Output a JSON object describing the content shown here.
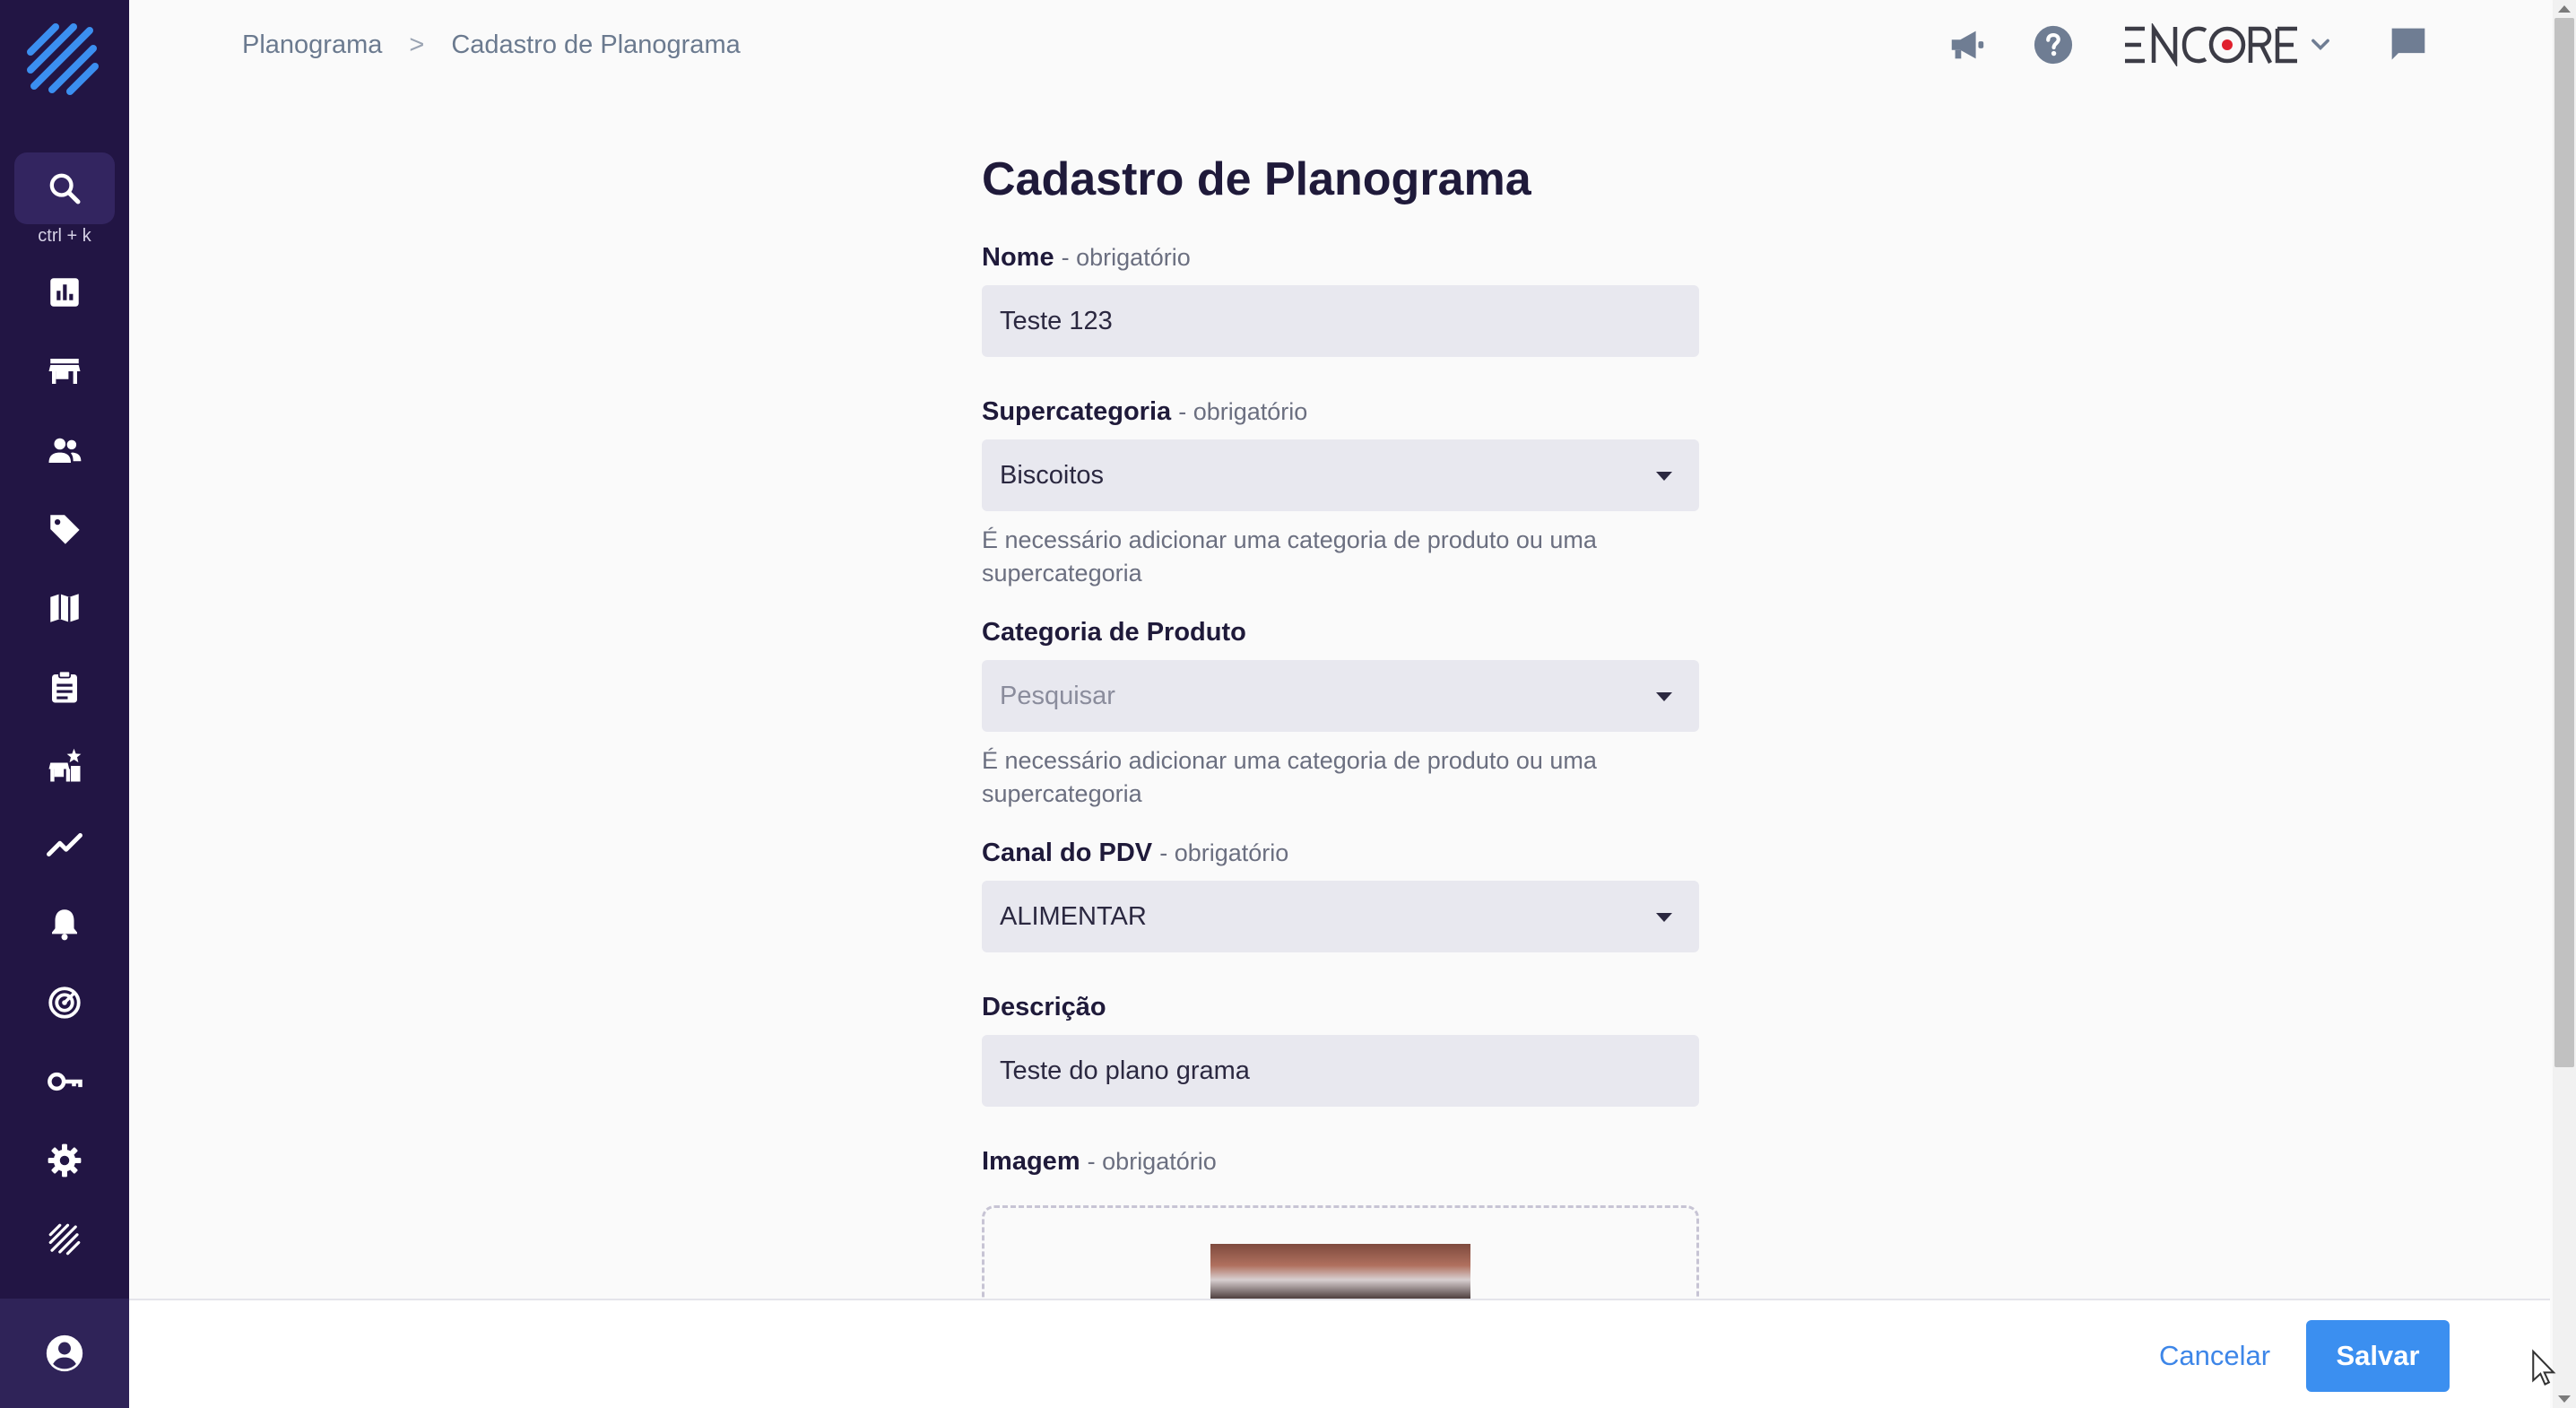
{
  "breadcrumb": {
    "items": [
      "Planograma",
      "Cadastro de Planograma"
    ],
    "separator": ">"
  },
  "brand": {
    "name": "ENCORE",
    "accent": "#e0202d"
  },
  "sidebar": {
    "search_hint": "ctrl + k",
    "items": [
      {
        "icon": "bar-chart-icon"
      },
      {
        "icon": "store-icon"
      },
      {
        "icon": "people-icon"
      },
      {
        "icon": "tag-icon"
      },
      {
        "icon": "map-icon"
      },
      {
        "icon": "clipboard-icon"
      },
      {
        "icon": "store-star-icon"
      },
      {
        "icon": "trend-line-icon"
      },
      {
        "icon": "bell-icon"
      },
      {
        "icon": "target-icon"
      },
      {
        "icon": "key-icon"
      },
      {
        "icon": "gear-icon"
      },
      {
        "icon": "brand-logo-icon"
      }
    ]
  },
  "form": {
    "title": "Cadastro de Planograma",
    "required_suffix": "- obrigatório",
    "nome": {
      "label": "Nome",
      "value": "Teste 123"
    },
    "supercategoria": {
      "label": "Supercategoria",
      "value": "Biscoitos",
      "help": "É necessário adicionar uma categoria de produto ou uma supercategoria"
    },
    "categoria": {
      "label": "Categoria de Produto",
      "placeholder": "Pesquisar",
      "help": "É necessário adicionar uma categoria de produto ou uma supercategoria"
    },
    "canal": {
      "label": "Canal do PDV",
      "value": "ALIMENTAR"
    },
    "descricao": {
      "label": "Descrição",
      "value": "Teste do plano grama"
    },
    "imagem": {
      "label": "Imagem"
    }
  },
  "footer": {
    "cancel_label": "Cancelar",
    "save_label": "Salvar"
  },
  "colors": {
    "sidebar_bg": "#221544",
    "primary": "#3b8ff0",
    "input_bg": "#e8e8ef"
  }
}
